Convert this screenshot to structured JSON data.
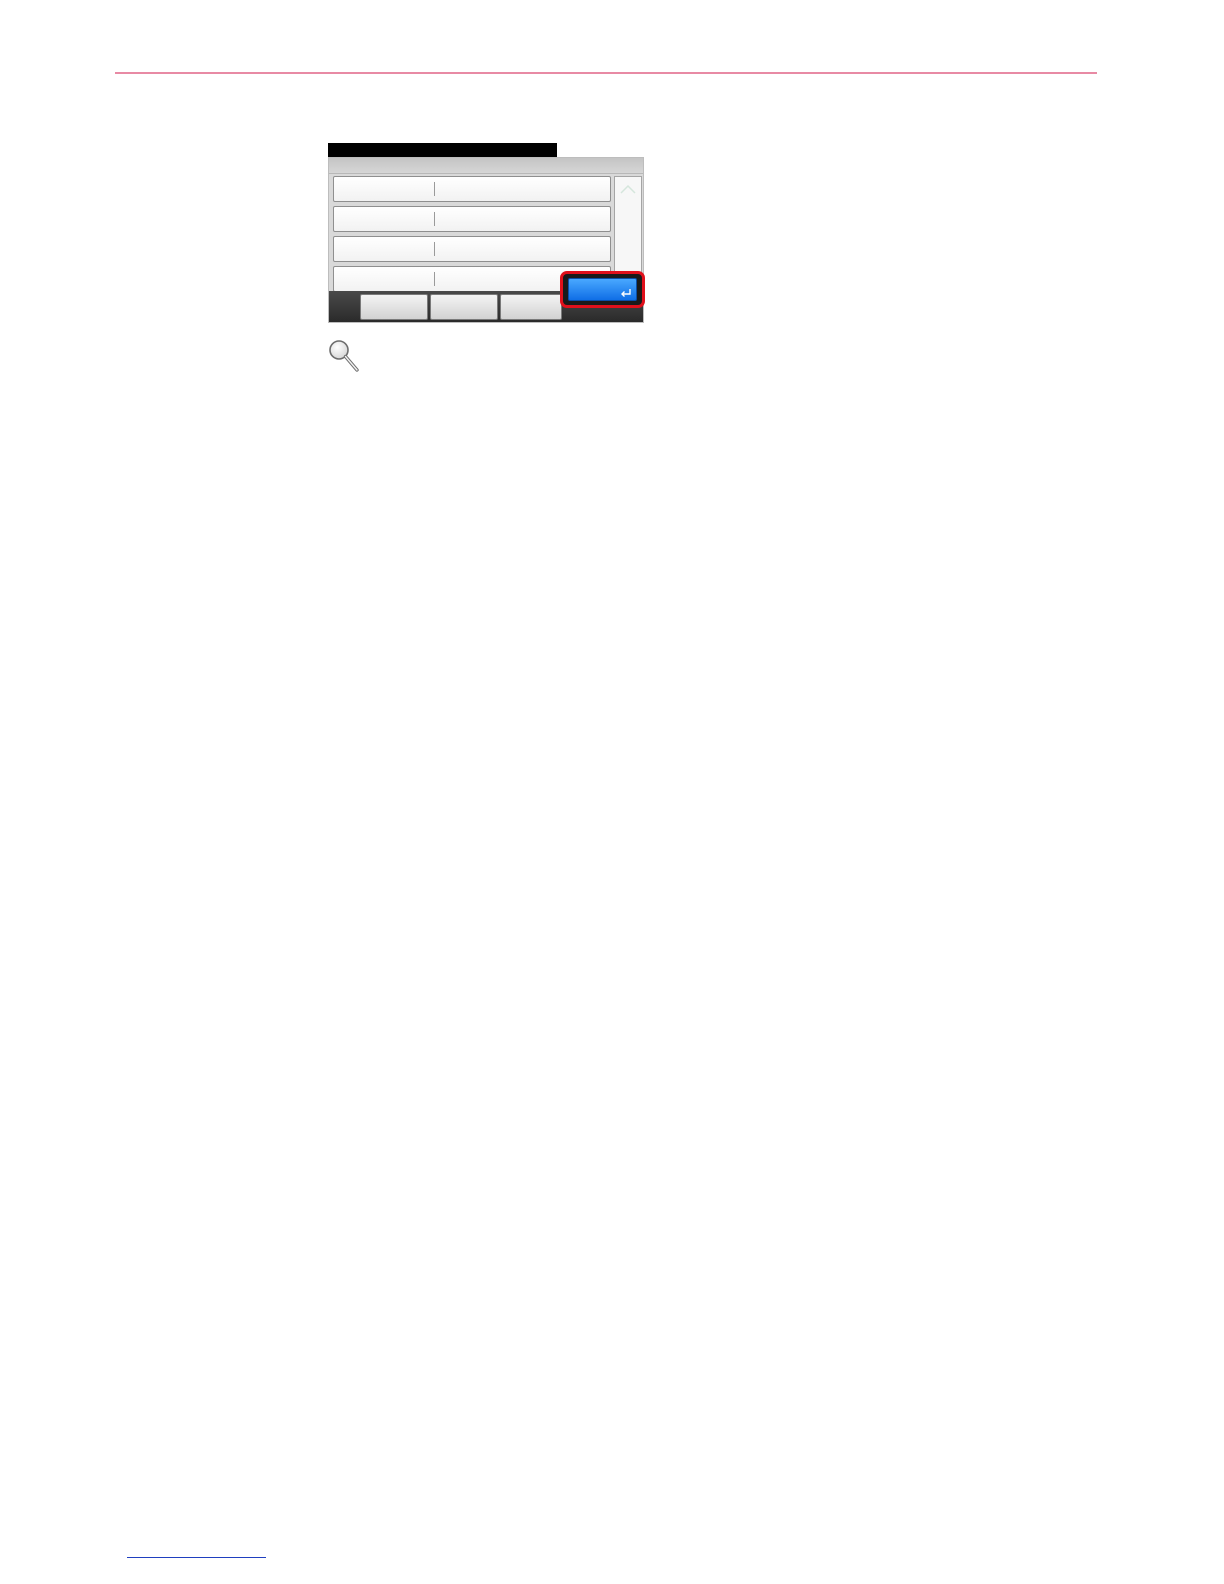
{
  "screen": {
    "title": "",
    "rows": [
      {
        "label": "",
        "value": ""
      },
      {
        "label": "",
        "value": ""
      },
      {
        "label": "",
        "value": ""
      },
      {
        "label": "",
        "value": ""
      }
    ],
    "footer_buttons": [
      "",
      "",
      ""
    ],
    "ok_label": "",
    "highlight_color": "#e0101b",
    "ok_color": "#1f7ff0"
  },
  "icons": {
    "scroll_up": "chevron-up-icon",
    "scroll_down": "chevron-down-icon",
    "enter": "enter-icon",
    "magnifier": "magnifier-icon"
  }
}
